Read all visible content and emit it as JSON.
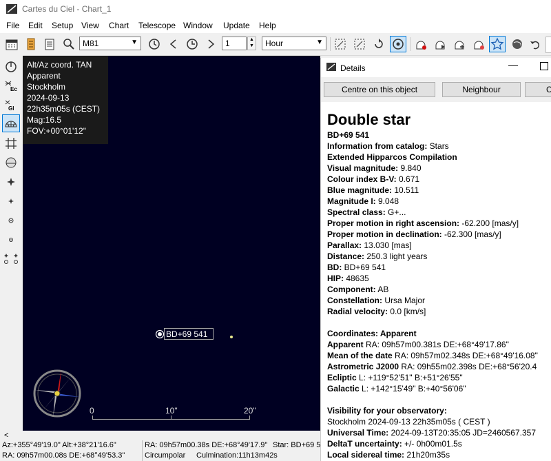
{
  "window": {
    "title": "Cartes du Ciel - Chart_1"
  },
  "menu": [
    "File",
    "Edit",
    "Setup",
    "View",
    "Chart",
    "Telescope",
    "Window",
    "Update",
    "Help"
  ],
  "toolbar": {
    "object_combo": "M81",
    "step_value": "1",
    "time_unit": "Hour"
  },
  "map": {
    "info": [
      "Alt/Az coord. TAN",
      "Apparent",
      "Stockholm",
      "2024-09-13",
      "22h35m05s (CEST)",
      "Mag:16.5",
      "FOV:+00°01'12\""
    ],
    "star_label": "BD+69 541",
    "scale": [
      "0",
      "10\"",
      "20\""
    ]
  },
  "details": {
    "title": "Details",
    "buttons": [
      "Centre on this object",
      "Neighbour",
      "C"
    ],
    "heading": "Double star",
    "name": "BD+69 541",
    "rows": [
      {
        "k": "Information from catalog:",
        "v": " Stars"
      },
      {
        "k": "Extended Hipparcos Compilation",
        "v": ""
      },
      {
        "k": "Visual magnitude:",
        "v": " 9.840"
      },
      {
        "k": "Colour index B-V:",
        "v": " 0.671"
      },
      {
        "k": "Blue magnitude:",
        "v": " 10.511"
      },
      {
        "k": "Magnitude I:",
        "v": " 9.048"
      },
      {
        "k": "Spectral class:",
        "v": " G+..."
      },
      {
        "k": "Proper motion in right ascension:",
        "v": " -62.200 [mas/y]"
      },
      {
        "k": "Proper motion in declination:",
        "v": " -62.300 [mas/y]"
      },
      {
        "k": "Parallax:",
        "v": " 13.030 [mas]"
      },
      {
        "k": "Distance:",
        "v": " 250.3 light years"
      },
      {
        "k": "BD:",
        "v": " BD+69 541"
      },
      {
        "k": "HIP:",
        "v": " 48635"
      },
      {
        "k": "Component:",
        "v": " AB"
      },
      {
        "k": "Constellation:",
        "v": " Ursa Major"
      },
      {
        "k": "Radial velocity:",
        "v": " 0.0 [km/s]"
      }
    ],
    "coords_heading": "Coordinates: Apparent",
    "coords": [
      {
        "k": "Apparent",
        "v": " RA: 09h57m00.381s DE:+68°49'17.86\""
      },
      {
        "k": "Mean of the date",
        "v": " RA: 09h57m02.348s DE:+68°49'16.08\""
      },
      {
        "k": "Astrometric J2000",
        "v": " RA: 09h55m02.398s DE:+68°56'20.4"
      },
      {
        "k": "Ecliptic",
        "v": "  L: +119°52'51\" B:+51°26'55\""
      },
      {
        "k": "Galactic",
        "v": "  L: +142°15'49\" B:+40°56'06\""
      }
    ],
    "vis_heading": "Visibility for your observatory:",
    "vis_line": "Stockholm 2024-09-13 22h35m05s ( CEST )",
    "vis": [
      {
        "k": "Universal Time:",
        "v": " 2024-09-13T20:35:05 JD=2460567.357"
      },
      {
        "k": "DeltaT uncertainty:",
        "v": "  +/- 0h00m01.5s"
      },
      {
        "k": "Local sidereal time:",
        "v": " 21h20m35s"
      }
    ]
  },
  "status": {
    "azalt": "Az:+355°49'19.0\" Alt:+38°21'16.6\"",
    "radec1": "RA: 09h57m00.08s DE:+68°49'53.3\"",
    "radec2": "RA: 09h57m00.38s DE:+68°49'17.9\"",
    "star": "Star: BD+69 5",
    "circumpolar": "Circumpolar",
    "culmination": "Culmination:11h13m42s"
  },
  "colors": {
    "map_bg": "#000022",
    "accent": "#0078d7"
  }
}
